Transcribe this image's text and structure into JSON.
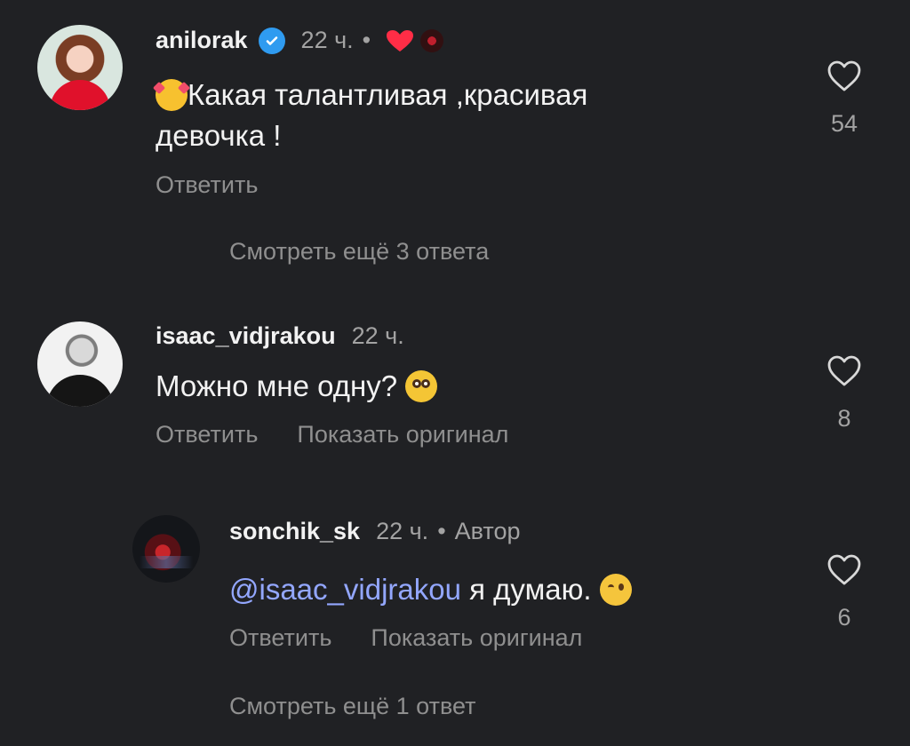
{
  "comments": [
    {
      "username": "anilorak",
      "time": "22 ч.",
      "text_line1": "Какая талантливая ,красивая",
      "text_line2": "девочка !",
      "reply_label": "Ответить",
      "likes": "54",
      "heart_color": "#ff2d46"
    },
    {
      "username": "isaac_vidjrakou",
      "time": "22 ч.",
      "text": "Можно мне одну?",
      "reply_label": "Ответить",
      "show_original_label": "Показать оригинал",
      "likes": "8"
    },
    {
      "username": "sonchik_sk",
      "time": "22 ч.",
      "author_label": "Автор",
      "mention": "@isaac_vidjrakou",
      "text": "я думаю.",
      "reply_label": "Ответить",
      "show_original_label": "Показать оригинал",
      "likes": "6"
    }
  ],
  "view_more_1": "Смотреть ещё 3 ответа",
  "view_more_2": "Смотреть ещё 1 ответ",
  "icons": {
    "verified": "verified-badge-icon",
    "heart": "heart-outline-icon"
  }
}
